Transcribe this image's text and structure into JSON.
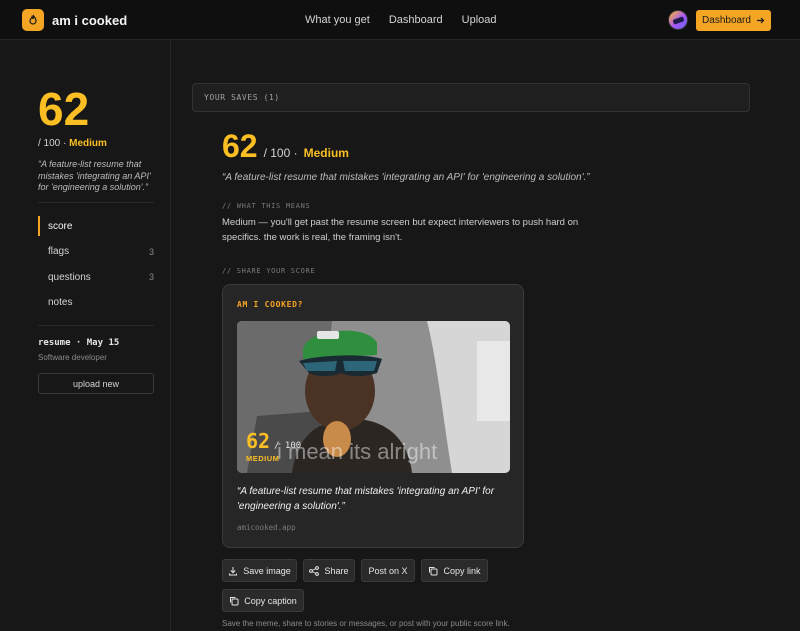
{
  "nav": {
    "brand": "am i cooked",
    "links": [
      "What you get",
      "Dashboard",
      "Upload"
    ],
    "dashboard_button": "Dashboard"
  },
  "sidebar": {
    "score": "62",
    "score_suffix": "/ 100 ·",
    "level": "Medium",
    "quote": "“A feature-list resume that mistakes 'integrating an API' for 'engineering a solution'.”",
    "items": [
      {
        "label": "score",
        "count": ""
      },
      {
        "label": "flags",
        "count": "3"
      },
      {
        "label": "questions",
        "count": "3"
      },
      {
        "label": "notes",
        "count": ""
      }
    ],
    "resume_title": "resume · May 15",
    "resume_subtitle": "Software developer",
    "upload_button": "upload new"
  },
  "main": {
    "saves_label": "YOUR SAVES (1)",
    "score": "62",
    "score_suffix": "/ 100 ·",
    "level": "Medium",
    "quote": "“A feature-list resume that mistakes 'integrating an API' for 'engineering a solution'.”",
    "meaning_label": "// WHAT THIS MEANS",
    "meaning_text": "Medium — you'll get past the resume screen but expect interviewers to push hard on specifics. the work is real, the framing isn't.",
    "share_label": "// SHARE YOUR SCORE"
  },
  "card": {
    "brand": "AM I COOKED?",
    "meme_score": "62",
    "meme_den": "/ 100",
    "meme_level": "MEDIUM",
    "meme_caption": "i mean its alright",
    "quote": "“A feature-list resume that mistakes 'integrating an API' for 'engineering a solution'.”",
    "url": "amicooked.app"
  },
  "actions": {
    "save_image": "Save image",
    "share": "Share",
    "post_x": "Post on X",
    "copy_link": "Copy link",
    "copy_caption": "Copy caption"
  },
  "footnote": "Save the meme, share to stories or messages, or post with your public score link.",
  "colors": {
    "accent": "#f5a524",
    "background": "#171717"
  }
}
